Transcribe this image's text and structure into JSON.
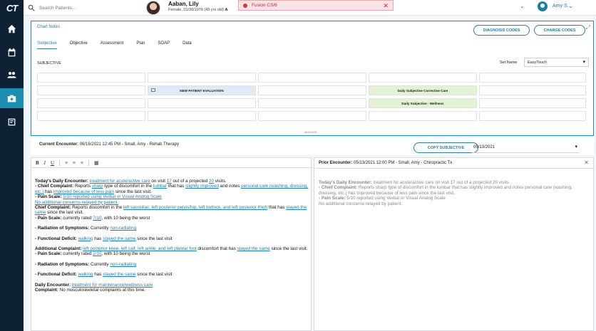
{
  "logo": "CT",
  "topbar": {
    "search_placeholder": "Search Patients...",
    "patient_name": "Aaban, Lily",
    "patient_info": "Female, 01/30/1976 (45 yrs old)",
    "patient_info_suffix": "A",
    "alert_text": "Fusion CS/6",
    "alert_close": "✕",
    "user_name": "Amy S."
  },
  "notes": {
    "title": "Chart Notes",
    "diagnosis_btn": "DIAGNOSIS CODES",
    "charge_btn": "CHARGE CODES",
    "tabs": [
      "Subjective",
      "Objective",
      "Assessment",
      "Plan",
      "SOAP",
      "Data"
    ],
    "active_tab": "Subjective",
    "section_label": "SUBJECTIVE",
    "set_name_label": "Set Name",
    "set_name_value": "EasyTouch",
    "cell_new_patient": "NEW PATIENT EVALUATION",
    "cell_daily_corrective": "Daily Subjective Corrective Care",
    "cell_daily_wellness": "Daily Subjective - Wellness",
    "collapse_label": "MINIMIZE"
  },
  "encounter": {
    "current_label": "Current Encounter:",
    "current_value": "06/16/2021 12:45 PM - Small, Amy - Rehab Therapy",
    "copy_btn": "COPY SUBJECTIVE",
    "date_select": "05/13/2021"
  },
  "editor": {
    "toolbar": [
      "B",
      "I",
      "U",
      "≡",
      "≡",
      "≡",
      "▦"
    ],
    "todays_label": "Today's Daily Encounter:",
    "t1": "treatment for acute/active care",
    "t2": "on visit",
    "t3": "17",
    "t4": "out of a projected",
    "t5": "20",
    "t6": "visits.",
    "cc_label": "- Chief Complaint:",
    "cc1": "Reports",
    "cc2": "sharp",
    "cc3": "type of discomfort in the",
    "cc4": "lumbar",
    "cc5": "that has",
    "cc6": "slightly improved",
    "cc7": "and notes",
    "cc8": "personal care (washing, dressing, etc.)",
    "cc9": "has",
    "cc10": "improved because of less pain",
    "cc11": "since the last visit.",
    "ps_label": "- Pain Scale:",
    "ps1": "5/10 reported using Verbal or Visual Analog Scale",
    "ps2": "No additional concerns relayed by patient.",
    "cc2_label": "Chief Complaint:",
    "cc2_1": "Reports discomfort in the",
    "cc2_2": "left sacroiliac, left posterior pelvis/hip, left buttock, and left posterior thigh",
    "cc2_3": "that has",
    "cc2_4": "stayed the same",
    "cc2_5": "since the last visit.",
    "ps2_label": "- Pain Scale:",
    "ps2_1": "currently rated",
    "ps2_2": "7/10",
    "ps2_3": ", with 10 being the worst",
    "rad_label": "- Radiation of Symptoms:",
    "rad1": "Currently",
    "rad2": "non-radiating",
    "fd_label": "- Functional Deficit:",
    "fd1": "walking",
    "fd2": "has",
    "fd3": "stayed the same",
    "fd4": "since the last visit",
    "ac_label": "Additional Complaint:",
    "ac1": "left posterior knee, left calf, left ankle, and left plantar foot",
    "ac2": "discomfort that has",
    "ac3": "stayed the same",
    "ac4": "since the last visit.",
    "ps3_label": "- Pain Scale:",
    "ps3_1": "currently rated",
    "ps3_2": "2/10",
    "ps3_3": ", with 10 being the worst",
    "rad2_label": "- Radiation of Symptoms:",
    "rad2_1": "Currently",
    "rad2_2": "non-radiating",
    "fd2_label": "- Functional Deficit:",
    "fd2_1": "walking",
    "fd2_2": "has",
    "fd2_3": "stayed the same",
    "fd2_4": "since the last visit",
    "de_label": "Daily Encounter:",
    "de1": "treatment for maintenance/wellness care",
    "comp_label": "Complaint:",
    "comp1": "No musculoskeletal complaints at this time."
  },
  "prior": {
    "label": "Prior Encounter:",
    "value": "05/13/2021 12:00 PM - Small, Amy - Chiropractic Tx",
    "close": "✕",
    "line1_label": "Today's Daily Encounter:",
    "line1": "treatment for acute/active care on visit 17 out of a projected 20 visits.",
    "line2_label": "- Chief Complaint:",
    "line2": "Reports sharp type of discomfort in the lumbar that has slightly improved and notes personal care (washing, dressing, etc.) has improved because of less pain since the last visit.",
    "line3_label": "- Pain Scale:",
    "line3": "5/10 reported using Verbal or Visual Analog Scale",
    "line4": "No additional concerns relayed by patient."
  }
}
